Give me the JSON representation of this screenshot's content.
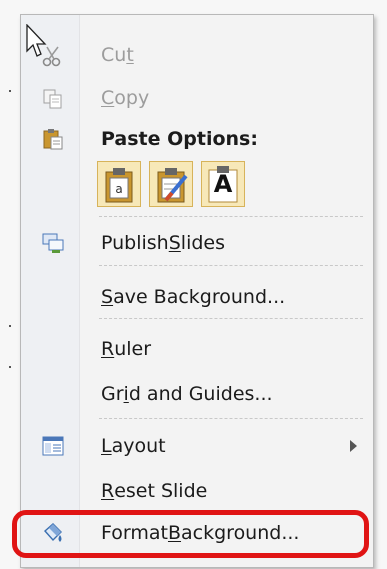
{
  "menu": {
    "cut": {
      "pre": "Cu",
      "acc": "t",
      "post": ""
    },
    "copy": {
      "pre": "",
      "acc": "C",
      "post": "opy"
    },
    "paste_options": "Paste Options:",
    "paste_btn_text": "A",
    "publish": {
      "pre": "Publish ",
      "acc": "S",
      "post": "lides"
    },
    "save_bg": {
      "pre": "",
      "acc": "S",
      "post": "ave Background..."
    },
    "ruler": {
      "pre": "",
      "acc": "R",
      "post": "uler"
    },
    "grid": {
      "pre": "Gr",
      "acc": "i",
      "post": "d and Guides..."
    },
    "layout": {
      "pre": "",
      "acc": "L",
      "post": "ayout"
    },
    "reset": {
      "pre": "",
      "acc": "R",
      "post": "eset Slide"
    },
    "format_bg": {
      "pre": "Format ",
      "acc": "B",
      "post": "ackground..."
    }
  },
  "colors": {
    "highlight": "#e01414",
    "menu_bg": "#f3f3f3",
    "disabled_text": "#9c9c9c"
  }
}
